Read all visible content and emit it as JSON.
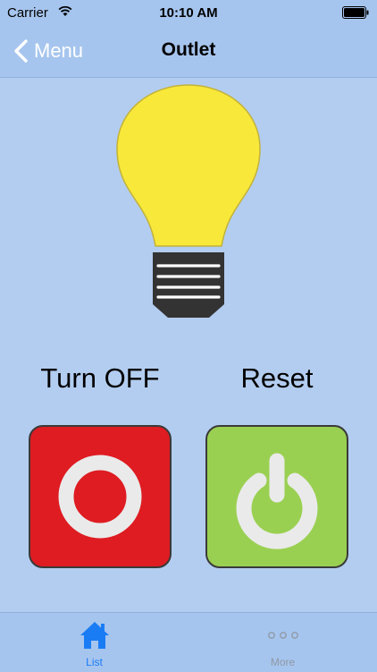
{
  "status_bar": {
    "carrier": "Carrier",
    "time": "10:10 AM"
  },
  "nav": {
    "back_label": "Menu",
    "title": "Outlet"
  },
  "controls": {
    "off_label": "Turn OFF",
    "reset_label": "Reset"
  },
  "colors": {
    "off_button": "#de1c22",
    "reset_button": "#9ad052",
    "bulb": "#f8e83a",
    "tab_active": "#1a7cf5"
  },
  "tabs": [
    {
      "label": "List",
      "icon": "home-icon",
      "active": true
    },
    {
      "label": "More",
      "icon": "more-dots-icon",
      "active": false
    }
  ]
}
